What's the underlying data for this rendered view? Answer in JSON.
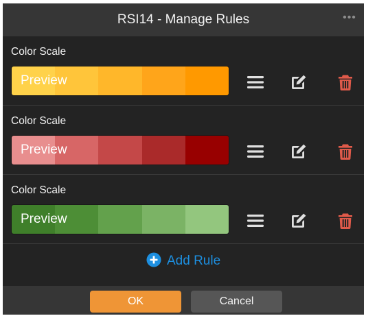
{
  "dialog": {
    "title": "RSI14 - Manage Rules",
    "more_icon": "ellipsis-icon",
    "more_text": "•••"
  },
  "rules": [
    {
      "label": "Color Scale",
      "preview_text": "Preview",
      "colors": [
        "#ffd24a",
        "#ffc53a",
        "#ffb72a",
        "#ffa51a",
        "#ff9900"
      ],
      "icons": [
        "menu-icon",
        "edit-icon",
        "trash-icon"
      ]
    },
    {
      "label": "Color Scale",
      "preview_text": "Preview",
      "colors": [
        "#e88e8e",
        "#d76666",
        "#c44848",
        "#aa2a2a",
        "#980000"
      ],
      "icons": [
        "menu-icon",
        "edit-icon",
        "trash-icon"
      ]
    },
    {
      "label": "Color Scale",
      "preview_text": "Preview",
      "colors": [
        "#3f7f2a",
        "#4d8e36",
        "#63a14c",
        "#7bb365",
        "#93c67e"
      ],
      "icons": [
        "menu-icon",
        "edit-icon",
        "trash-icon"
      ]
    }
  ],
  "add_rule": {
    "label": "Add Rule",
    "icon": "plus-circle-icon"
  },
  "footer": {
    "ok_label": "OK",
    "cancel_label": "Cancel"
  },
  "colors": {
    "background": "#232323",
    "header": "#363636",
    "accent_blue": "#1d8fe0",
    "ok": "#ef9536",
    "cancel": "#565656",
    "delete_red": "#e05a4a",
    "icon": "#e0e0e0"
  }
}
